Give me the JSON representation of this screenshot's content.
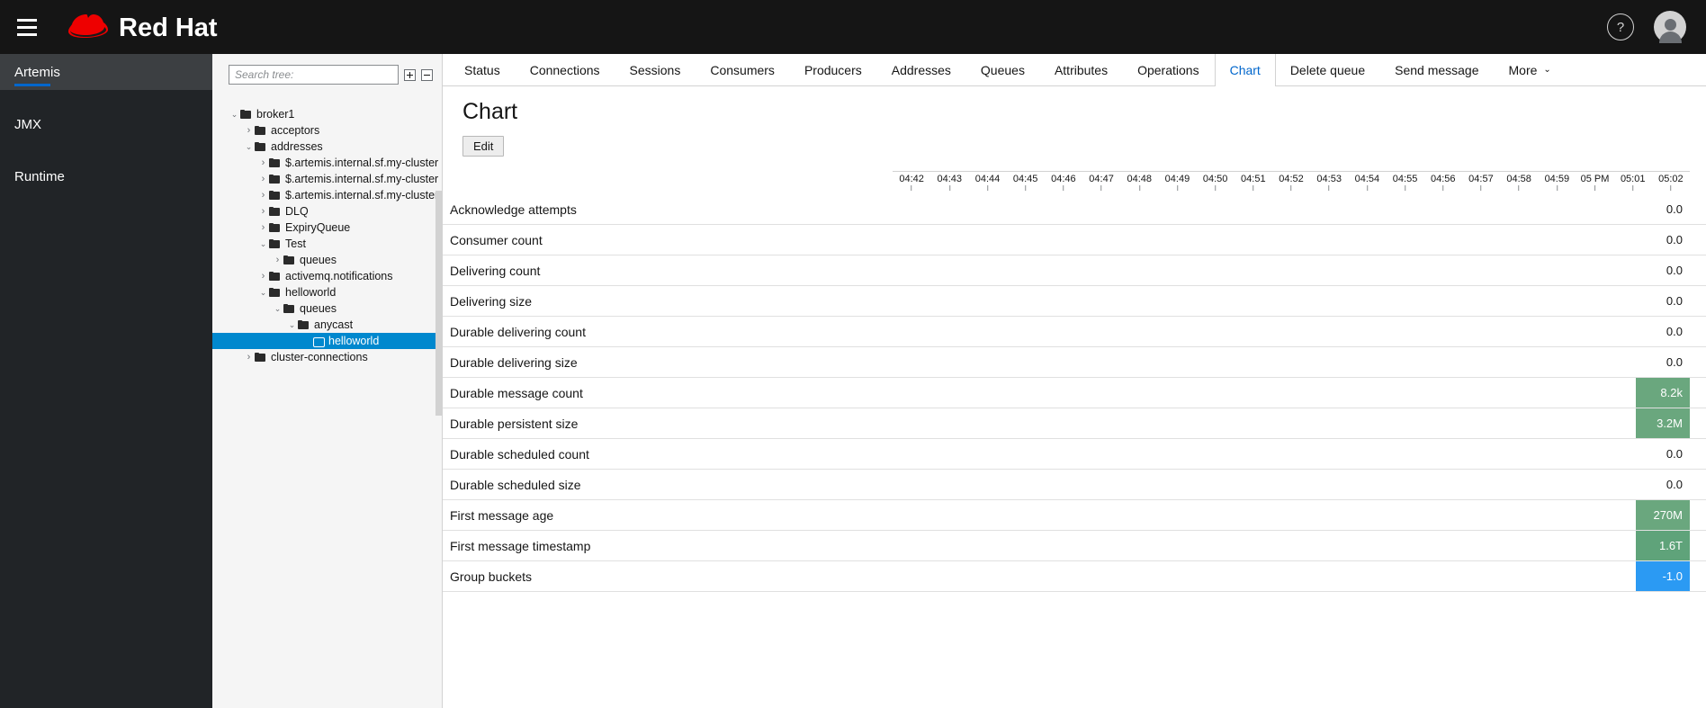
{
  "masthead": {
    "brand_text": "Red Hat",
    "hamburger_label": "Global navigation toggle",
    "help_glyph": "?",
    "help_label": "Help"
  },
  "sidenav": {
    "items": [
      {
        "label": "Artemis",
        "active": true
      },
      {
        "label": "JMX",
        "active": false
      },
      {
        "label": "Runtime",
        "active": false
      }
    ]
  },
  "tree_panel": {
    "search": {
      "placeholder": "Search tree:",
      "value": ""
    },
    "expand_all_label": "Expand all",
    "collapse_all_label": "Collapse all",
    "nodes": [
      {
        "label": "broker1",
        "indent": 0,
        "caret": "down",
        "icon": "folder",
        "selected": false
      },
      {
        "label": "acceptors",
        "indent": 1,
        "caret": "right",
        "icon": "folder",
        "selected": false
      },
      {
        "label": "addresses",
        "indent": 1,
        "caret": "down",
        "icon": "folder",
        "selected": false
      },
      {
        "label": "$.artemis.internal.sf.my-cluster....",
        "indent": 2,
        "caret": "right",
        "icon": "folder",
        "selected": false
      },
      {
        "label": "$.artemis.internal.sf.my-cluster....",
        "indent": 2,
        "caret": "right",
        "icon": "folder",
        "selected": false
      },
      {
        "label": "$.artemis.internal.sf.my-cluster....",
        "indent": 2,
        "caret": "right",
        "icon": "folder",
        "selected": false
      },
      {
        "label": "DLQ",
        "indent": 2,
        "caret": "right",
        "icon": "folder",
        "selected": false
      },
      {
        "label": "ExpiryQueue",
        "indent": 2,
        "caret": "right",
        "icon": "folder",
        "selected": false
      },
      {
        "label": "Test",
        "indent": 2,
        "caret": "down",
        "icon": "folder",
        "selected": false
      },
      {
        "label": "queues",
        "indent": 3,
        "caret": "right",
        "icon": "folder",
        "selected": false
      },
      {
        "label": "activemq.notifications",
        "indent": 2,
        "caret": "right",
        "icon": "folder",
        "selected": false
      },
      {
        "label": "helloworld",
        "indent": 2,
        "caret": "down",
        "icon": "folder",
        "selected": false
      },
      {
        "label": "queues",
        "indent": 3,
        "caret": "down",
        "icon": "folder",
        "selected": false
      },
      {
        "label": "anycast",
        "indent": 4,
        "caret": "down",
        "icon": "folder",
        "selected": false
      },
      {
        "label": "helloworld",
        "indent": 5,
        "caret": "none",
        "icon": "queue",
        "selected": true
      },
      {
        "label": "cluster-connections",
        "indent": 1,
        "caret": "right",
        "icon": "folder",
        "selected": false
      }
    ]
  },
  "tabs": [
    {
      "label": "Status",
      "active": false
    },
    {
      "label": "Connections",
      "active": false
    },
    {
      "label": "Sessions",
      "active": false
    },
    {
      "label": "Consumers",
      "active": false
    },
    {
      "label": "Producers",
      "active": false
    },
    {
      "label": "Addresses",
      "active": false
    },
    {
      "label": "Queues",
      "active": false
    },
    {
      "label": "Attributes",
      "active": false
    },
    {
      "label": "Operations",
      "active": false
    },
    {
      "label": "Chart",
      "active": true
    },
    {
      "label": "Delete queue",
      "active": false
    },
    {
      "label": "Send message",
      "active": false
    },
    {
      "label": "More",
      "active": false,
      "chevron": "⌄"
    }
  ],
  "page": {
    "title": "Chart",
    "edit_label": "Edit"
  },
  "chart_data": {
    "type": "table",
    "title": "Chart",
    "xlabel": "",
    "ylabel": "",
    "grid": false,
    "legend": "none",
    "x_ticks": [
      "04:42",
      "04:43",
      "04:44",
      "04:45",
      "04:46",
      "04:47",
      "04:48",
      "04:49",
      "04:50",
      "04:51",
      "04:52",
      "04:53",
      "04:54",
      "04:55",
      "04:56",
      "04:57",
      "04:58",
      "04:59",
      "05 PM",
      "05:01",
      "05:02"
    ],
    "categories": [
      "Acknowledge attempts",
      "Consumer count",
      "Delivering count",
      "Delivering size",
      "Durable delivering count",
      "Durable delivering size",
      "Durable message count",
      "Durable persistent size",
      "Durable scheduled count",
      "Durable scheduled size",
      "First message age",
      "First message timestamp",
      "Group buckets"
    ],
    "rows": [
      {
        "label": "Acknowledge attempts",
        "value": "0.0",
        "bar": false,
        "color": ""
      },
      {
        "label": "Consumer count",
        "value": "0.0",
        "bar": false,
        "color": ""
      },
      {
        "label": "Delivering count",
        "value": "0.0",
        "bar": false,
        "color": ""
      },
      {
        "label": "Delivering size",
        "value": "0.0",
        "bar": false,
        "color": ""
      },
      {
        "label": "Durable delivering count",
        "value": "0.0",
        "bar": false,
        "color": ""
      },
      {
        "label": "Durable delivering size",
        "value": "0.0",
        "bar": false,
        "color": ""
      },
      {
        "label": "Durable message count",
        "value": "8.2k",
        "bar": true,
        "color": "#6aa77e"
      },
      {
        "label": "Durable persistent size",
        "value": "3.2M",
        "bar": true,
        "color": "#6aa77e"
      },
      {
        "label": "Durable scheduled count",
        "value": "0.0",
        "bar": false,
        "color": ""
      },
      {
        "label": "Durable scheduled size",
        "value": "0.0",
        "bar": false,
        "color": ""
      },
      {
        "label": "First message age",
        "value": "270M",
        "bar": true,
        "color": "#6aa77e"
      },
      {
        "label": "First message timestamp",
        "value": "1.6T",
        "bar": true,
        "color": "#5fa37a"
      },
      {
        "label": "Group buckets",
        "value": "-1.0",
        "bar": true,
        "color": "#2b9af3"
      }
    ],
    "values": [
      0.0,
      0.0,
      0.0,
      0.0,
      0.0,
      0.0,
      8200,
      3200000,
      0.0,
      0.0,
      270000000,
      1600000000000,
      -1.0
    ]
  },
  "colors": {
    "brand_red": "#ee0000",
    "accent_blue": "#0066cc",
    "selection_blue": "#0088ce",
    "badge_green": "#6aa77e",
    "badge_blue": "#2b9af3",
    "masthead_bg": "#151515",
    "sidenav_bg": "#212427"
  }
}
